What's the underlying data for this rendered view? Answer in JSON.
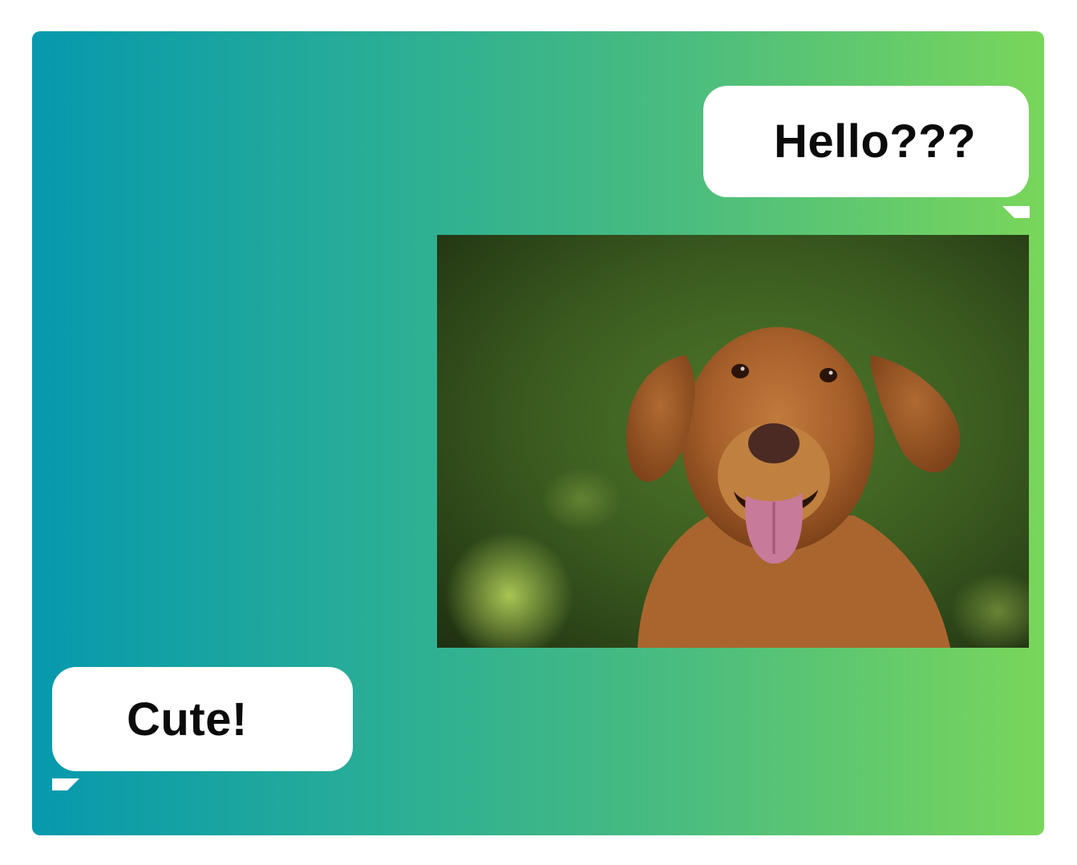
{
  "messages": {
    "top_right": "Hello???",
    "bottom_left": "Cute!"
  },
  "photo": {
    "subject": "golden-retriever-dog"
  },
  "colors": {
    "gradient_start": "#0699ae",
    "gradient_end": "#79d65b",
    "bubble": "#ffffff",
    "text": "#0b0b0b"
  }
}
